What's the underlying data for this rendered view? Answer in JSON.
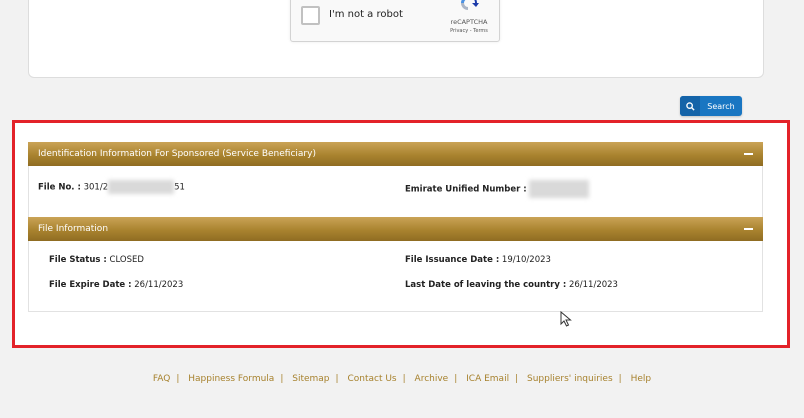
{
  "recaptcha": {
    "label": "I'm not a robot",
    "brand": "reCAPTCHA",
    "terms": "Privacy - Terms"
  },
  "search": {
    "label": "Search",
    "icon": "search-icon"
  },
  "sponsored": {
    "title": "Identification Information For Sponsored (Service Beneficiary)",
    "file_no_label": "File No. :",
    "file_no_prefix": "301/2",
    "file_no_suffix": "51",
    "emirate_label": "Emirate Unified Number :"
  },
  "file_info": {
    "title": "File Information",
    "status_label": "File Status :",
    "status_value": "CLOSED",
    "issuance_label": "File Issuance Date :",
    "issuance_value": "19/10/2023",
    "expire_label": "File Expire Date :",
    "expire_value": "26/11/2023",
    "last_leave_label": "Last Date of leaving the country :",
    "last_leave_value": "26/11/2023"
  },
  "footer": {
    "links": [
      "FAQ",
      "Happiness Formula",
      "Sitemap",
      "Contact Us",
      "Archive",
      "ICA Email",
      "Suppliers' inquiries",
      "Help"
    ]
  },
  "colors": {
    "gold_header": "#a9832f",
    "highlight_border": "#e32229",
    "button_blue": "#1976c2",
    "footer_link": "#a7822e"
  }
}
